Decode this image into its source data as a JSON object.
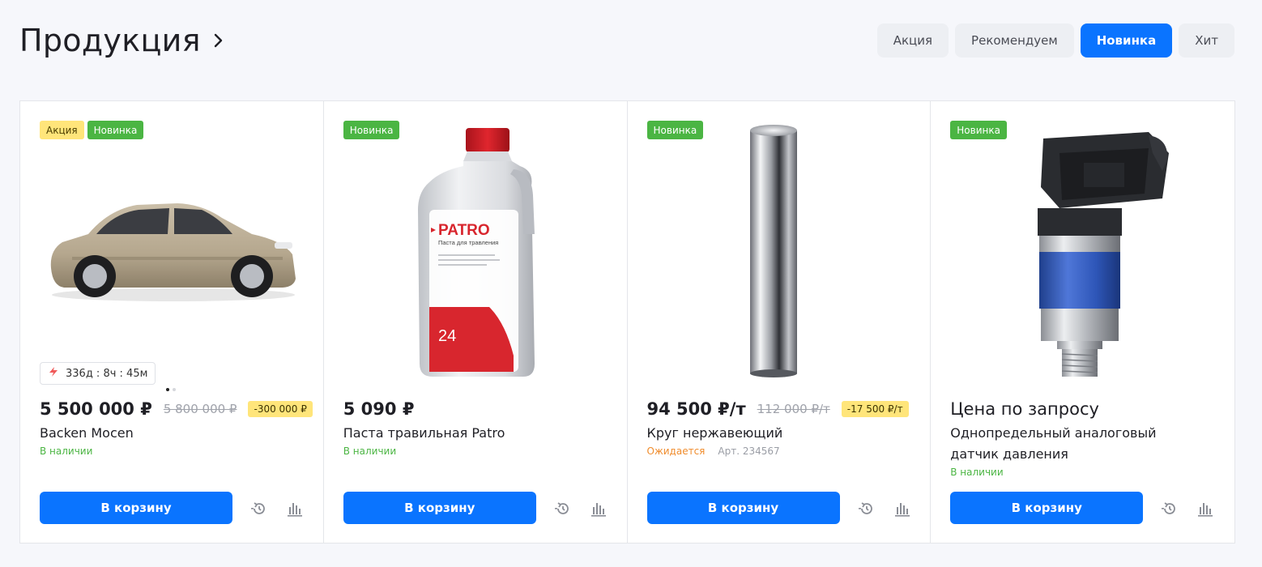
{
  "header": {
    "title": "Продукция",
    "tabs": [
      {
        "label": "Акция",
        "active": false
      },
      {
        "label": "Рекомендуем",
        "active": false
      },
      {
        "label": "Новинка",
        "active": true
      },
      {
        "label": "Хит",
        "active": false
      }
    ]
  },
  "colors": {
    "accent": "#0a74ff",
    "sticker_new": "#4bb543",
    "sticker_sale": "#ffe57a",
    "status_in_stock": "#4bb543",
    "status_expected": "#f08c2c"
  },
  "products": [
    {
      "stickers": [
        "Акция",
        "Новинка"
      ],
      "image": "car-image",
      "timer": "336д : 8ч : 45м",
      "price": "5 500 000 ₽",
      "old_price": "5 800 000 ₽",
      "economy": "-300 000 ₽",
      "name": "Backen Mocen",
      "status": "В наличии",
      "buy_label": "В корзину"
    },
    {
      "stickers": [
        "Новинка"
      ],
      "image": "bottle-image",
      "bottle_brand": "PATRO",
      "bottle_subtitle": "Паста для травления",
      "bottle_number": "24",
      "price": "5 090 ₽",
      "name": "Паста травильная Patro",
      "status": "В наличии",
      "buy_label": "В корзину"
    },
    {
      "stickers": [
        "Новинка"
      ],
      "image": "steel-rod-image",
      "price": "94 500 ₽/т",
      "old_price": "112 000 ₽/т",
      "economy": "-17 500 ₽/т",
      "name": "Круг нержавеющий",
      "status": "Ожидается",
      "article": "Арт. 234567",
      "buy_label": "В корзину"
    },
    {
      "stickers": [
        "Новинка"
      ],
      "image": "pressure-sensor-image",
      "price": "Цена по запросу",
      "name": "Однопредельный аналоговый датчик давления",
      "status": "В наличии",
      "buy_label": "В корзину"
    }
  ]
}
